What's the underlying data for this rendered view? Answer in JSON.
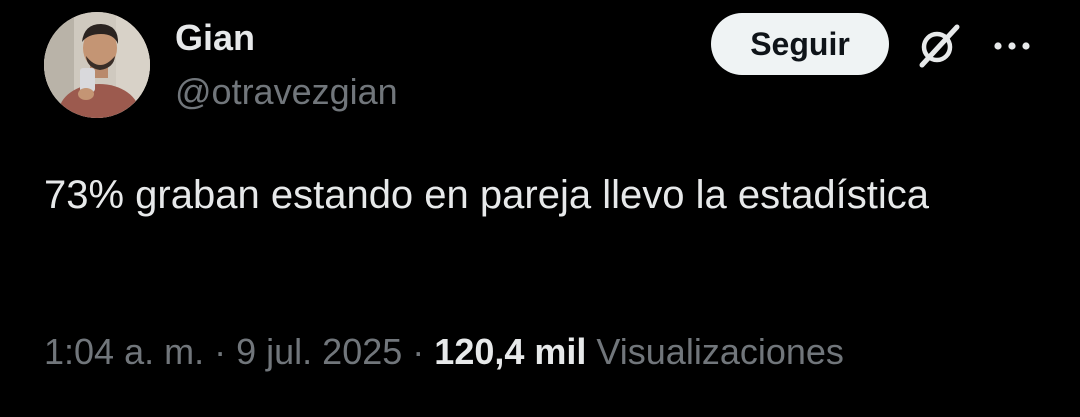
{
  "author": {
    "name": "Gian",
    "handle": "@otravezgian",
    "avatar": "profile-photo"
  },
  "actions": {
    "follow_label": "Seguir",
    "grok_icon": "grok-icon",
    "more_icon": "more-options-icon"
  },
  "tweet": {
    "text": "73% graban estando en pareja llevo la estadística"
  },
  "meta": {
    "time": "1:04 a. m.",
    "separator": "·",
    "date": "9 jul. 2025",
    "views_count": "120,4 mil",
    "views_label": "Visualizaciones"
  },
  "colors": {
    "background": "#000000",
    "primary_text": "#e7e9ea",
    "secondary_text": "#71767b",
    "button_bg": "#eff3f4",
    "button_text": "#0f1419"
  }
}
